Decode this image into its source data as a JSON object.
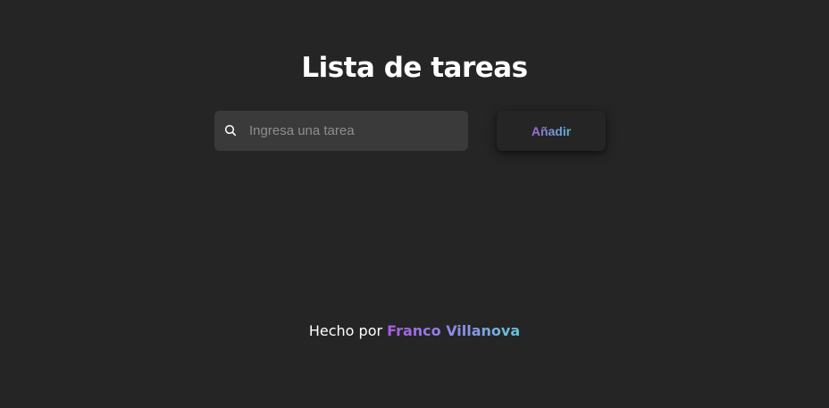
{
  "header": {
    "title": "Lista de tareas"
  },
  "task_form": {
    "search_icon": "search-icon",
    "input_value": "",
    "input_placeholder": "Ingresa una tarea",
    "add_button_label": "Añadir"
  },
  "footer": {
    "prefix": "Hecho por",
    "author": "Franco Villanova"
  },
  "colors": {
    "background": "#252525",
    "input_background": "#3a3a3a",
    "gradient_start": "#a45ee0",
    "gradient_end": "#63c5d8"
  }
}
